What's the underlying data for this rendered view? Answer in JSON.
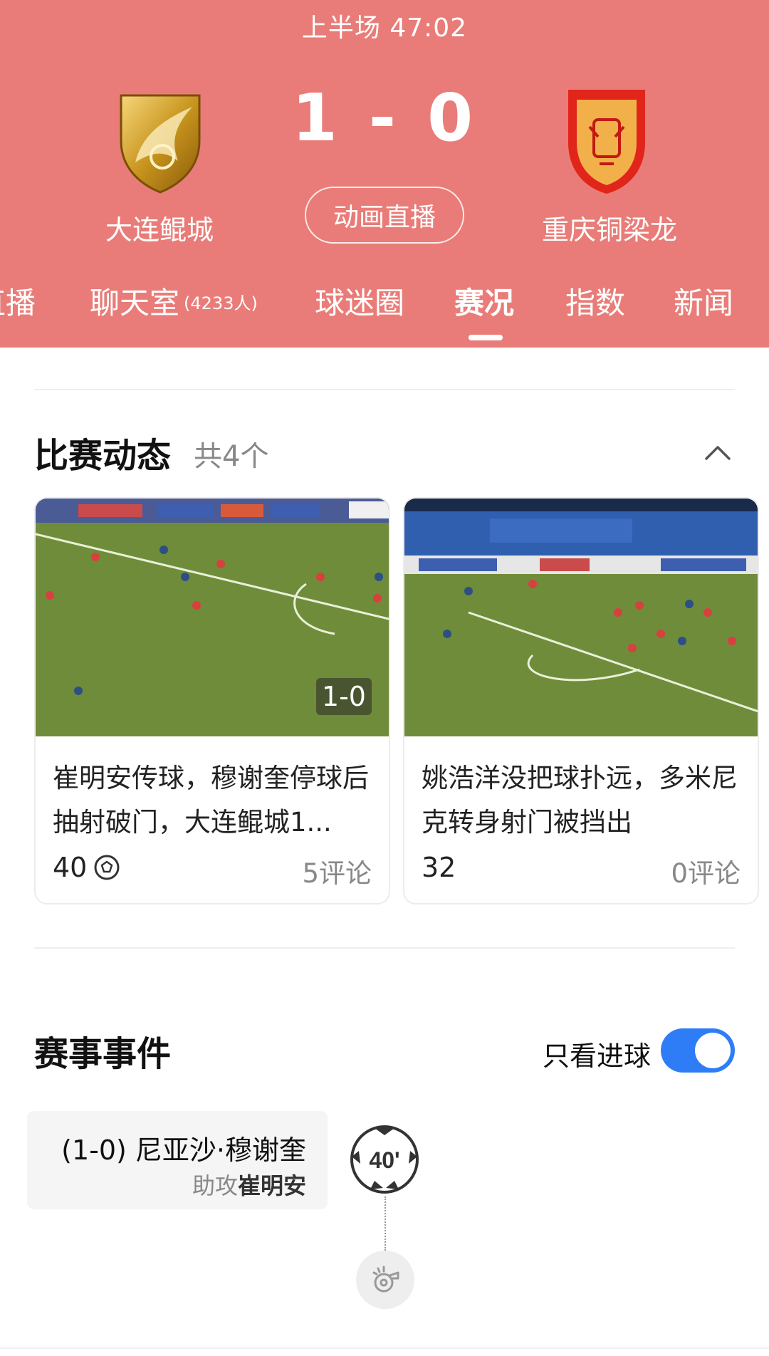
{
  "header": {
    "period": "上半场 47:02",
    "score": "1 - 0",
    "home_team": "大连鲲城",
    "away_team": "重庆铜梁龙",
    "live_button": "动画直播",
    "bg_color": "#e97c78"
  },
  "tabs": [
    {
      "label": "直播"
    },
    {
      "label": "聊天室",
      "badge": "(4233人)"
    },
    {
      "label": "球迷圈"
    },
    {
      "label": "赛况",
      "active": true
    },
    {
      "label": "指数"
    },
    {
      "label": "新闻"
    }
  ],
  "dynamics": {
    "title": "比赛动态",
    "count": "共4个",
    "cards": [
      {
        "score_badge": "1-0",
        "title": "崔明安传球，穆谢奎停球后抽射破门，大连鲲城1...",
        "likes": "40",
        "comments": "5评论"
      },
      {
        "title": "姚浩洋没把球扑远，多米尼克转身射门被挡出",
        "likes": "32",
        "comments": "0评论"
      }
    ]
  },
  "events": {
    "title": "赛事事件",
    "toggle_label": "只看进球",
    "toggle_on": true,
    "toggle_color": "#2f7df6",
    "items": [
      {
        "main": "(1-0) 尼亚沙·穆谢奎",
        "assist_label": "助攻",
        "assist_name": "崔明安",
        "minute": "40'"
      }
    ]
  }
}
